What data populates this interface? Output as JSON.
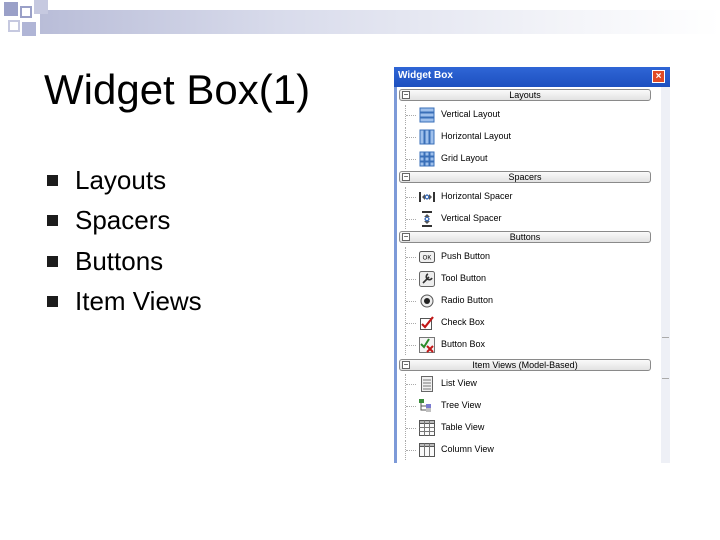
{
  "slide": {
    "title": "Widget Box(1)",
    "bullets": [
      "Layouts",
      "Spacers",
      "Buttons",
      "Item Views"
    ]
  },
  "widget_box": {
    "title": "Widget Box",
    "close_glyph": "×",
    "collapse_glyph": "−",
    "categories": [
      {
        "label": "Layouts",
        "items": [
          {
            "label": "Vertical Layout",
            "icon": "vertical-layout-icon"
          },
          {
            "label": "Horizontal Layout",
            "icon": "horizontal-layout-icon"
          },
          {
            "label": "Grid Layout",
            "icon": "grid-layout-icon"
          }
        ]
      },
      {
        "label": "Spacers",
        "items": [
          {
            "label": "Horizontal Spacer",
            "icon": "horizontal-spacer-icon"
          },
          {
            "label": "Vertical Spacer",
            "icon": "vertical-spacer-icon"
          }
        ]
      },
      {
        "label": "Buttons",
        "items": [
          {
            "label": "Push Button",
            "icon": "push-button-icon",
            "icon_text": "OK"
          },
          {
            "label": "Tool Button",
            "icon": "tool-button-icon"
          },
          {
            "label": "Radio Button",
            "icon": "radio-button-icon"
          },
          {
            "label": "Check Box",
            "icon": "check-box-icon"
          },
          {
            "label": "Button Box",
            "icon": "button-box-icon"
          }
        ]
      },
      {
        "label": "Item Views (Model-Based)",
        "items": [
          {
            "label": "List View",
            "icon": "list-view-icon"
          },
          {
            "label": "Tree View",
            "icon": "tree-view-icon"
          },
          {
            "label": "Table View",
            "icon": "table-view-icon"
          },
          {
            "label": "Column View",
            "icon": "column-view-icon"
          }
        ]
      }
    ]
  },
  "colors": {
    "title_bar": "#2f66d6",
    "frame": "#7d9ad8",
    "close": "#e04a25",
    "bullet": "#1c1c1c"
  }
}
